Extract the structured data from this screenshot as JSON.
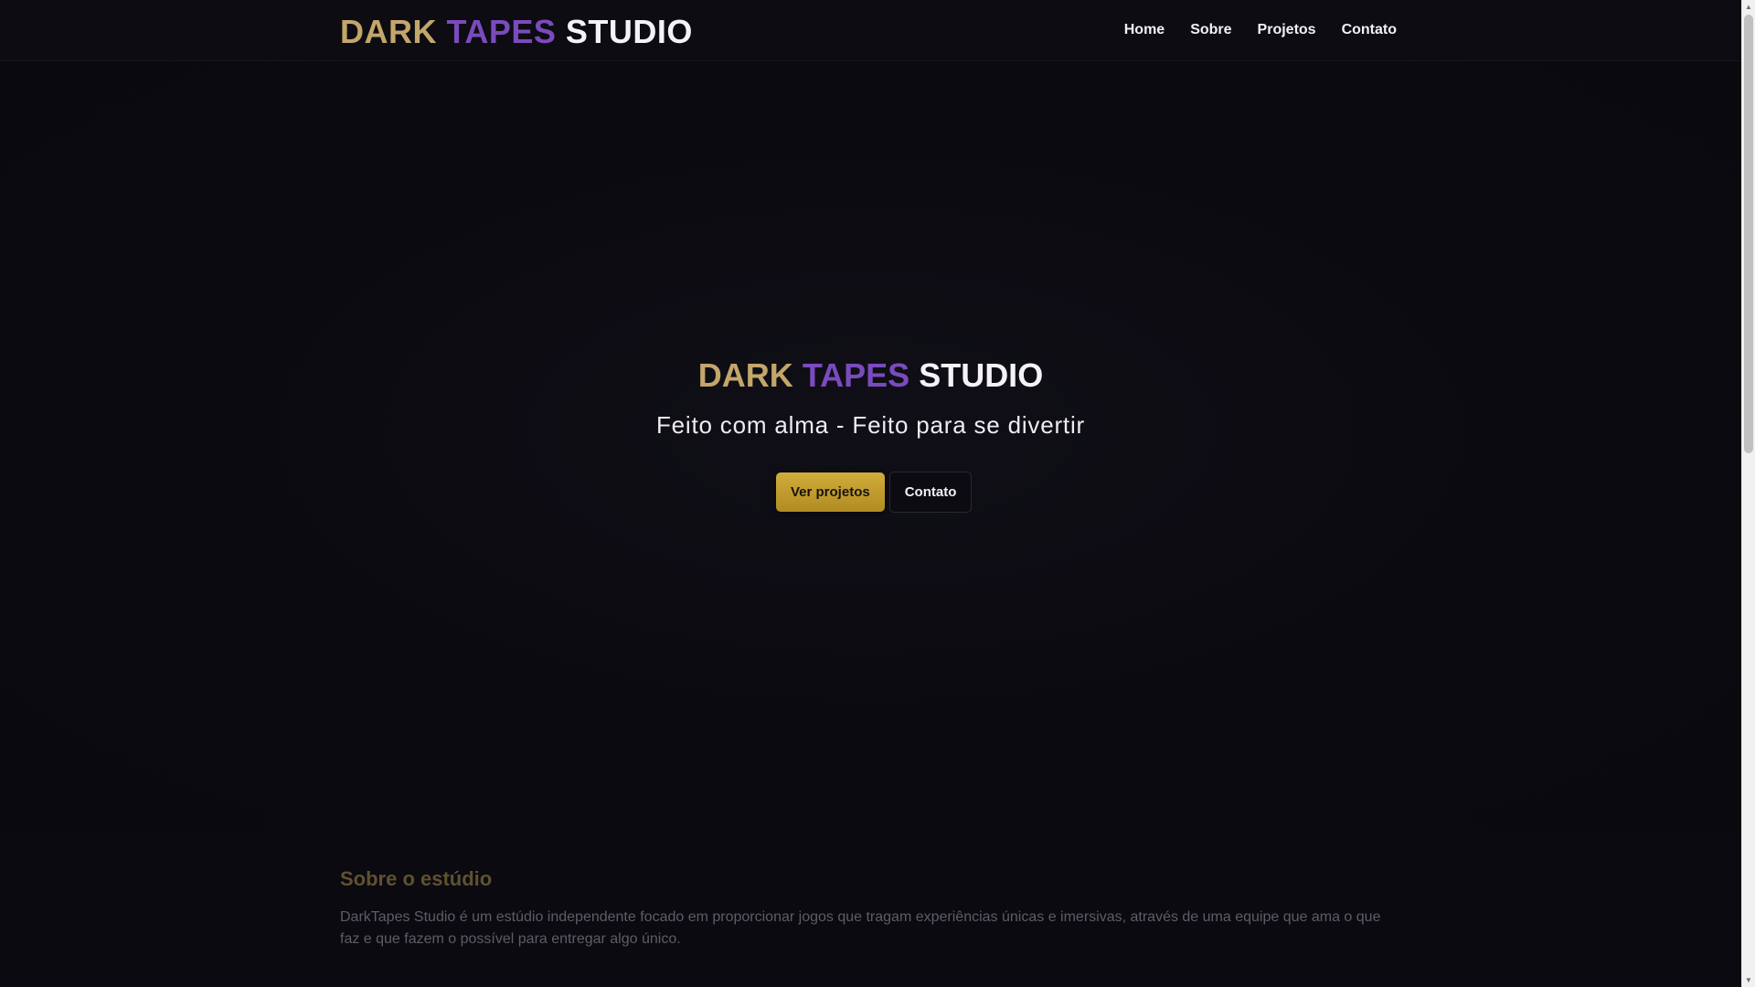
{
  "header": {
    "logo": {
      "dark": "DARK",
      "tapes": "TAPES",
      "studio": "STUDIO"
    },
    "nav": [
      {
        "label": "Home"
      },
      {
        "label": "Sobre"
      },
      {
        "label": "Projetos"
      },
      {
        "label": "Contato"
      }
    ]
  },
  "hero": {
    "title": {
      "dark": "DARK",
      "tapes": "TAPES",
      "studio": "STUDIO"
    },
    "subtitle": "Feito com alma - Feito para se divertir",
    "primary_button": "Ver projetos",
    "secondary_button": "Contato"
  },
  "about": {
    "title": "Sobre o estúdio",
    "text": "DarkTapes Studio é um estúdio independente focado em proporcionar jogos que tragam experiências únicas e imersivas, através de uma equipe que ama o que faz e que fazem o possível para entregar algo único."
  },
  "colors": {
    "background": "#0b0a10",
    "gold": "#c3a66a",
    "purple": "#7a4bbd",
    "button_gold": "#c9a32f"
  },
  "icons": {
    "scroll_up": "scroll-up-arrow-icon",
    "scroll_down": "scroll-down-arrow-icon"
  }
}
